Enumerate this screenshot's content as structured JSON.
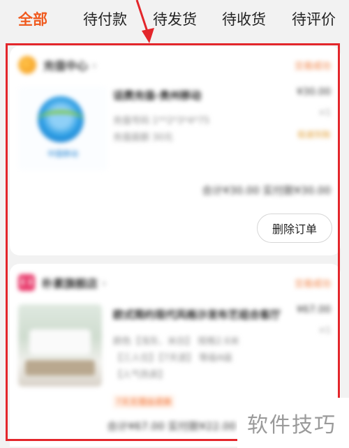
{
  "tabs": [
    {
      "label": "全部",
      "active": true
    },
    {
      "label": "待付款",
      "active": false
    },
    {
      "label": "待发货",
      "active": false
    },
    {
      "label": "待收货",
      "active": false
    },
    {
      "label": "待评价",
      "active": false
    }
  ],
  "orders": [
    {
      "shop_name": "充值中心",
      "status": "交易成功",
      "thumb_text": "中国移动",
      "title": "话费充值-贵州移动",
      "details": [
        "充值号码 1**2*3*4*75",
        "充值面额 30元"
      ],
      "price": "¥30.00",
      "qty": "×1",
      "tag": "极速到账",
      "total": "合计¥30.00 实付款¥30.00",
      "action": "删除订单"
    },
    {
      "shop_name": "朴素旗舰店",
      "status": "交易成功",
      "title": "欧式简约现代风格沙发布艺组合客厅",
      "details": [
        "颜色【浅灰、米白】 规格2.6米",
        "【三人位】【7天退】 等级A级",
        "【人气热卖】"
      ],
      "price": "¥67.00",
      "qty": "×1",
      "promo": "7天无理由退换",
      "total": "合计¥67.00 实付款¥22.00"
    }
  ],
  "watermark": "软件技巧",
  "colors": {
    "accent": "#f05a1e",
    "annotation": "#e3262b",
    "status": "#ef7a3a"
  }
}
